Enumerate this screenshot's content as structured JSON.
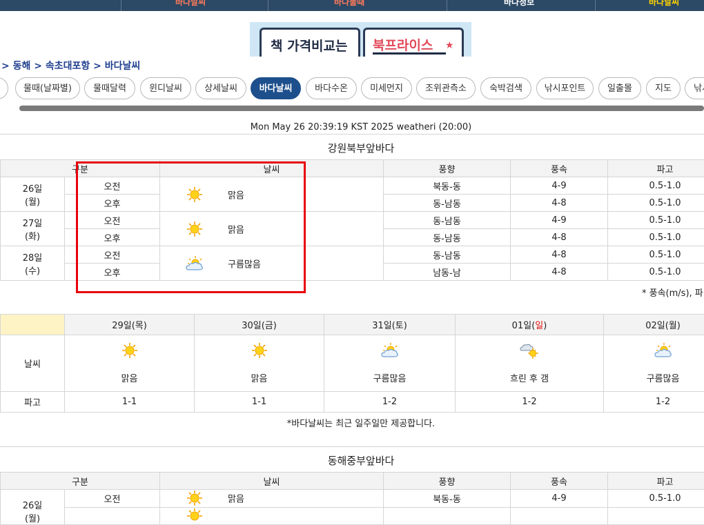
{
  "topnav": {
    "items": [
      "바다날씨",
      "바다날씨",
      "바다물때",
      "바다정보"
    ]
  },
  "banner": {
    "text_left": "책 가격비교는",
    "text_right": "북프라이스"
  },
  "breadcrumb": "> 동해 > 속초대포항 > 바다날씨",
  "tabs": [
    "물때(날짜별)",
    "물때달력",
    "윈디날씨",
    "상세날씨",
    "바다날씨",
    "바다수온",
    "미세먼지",
    "조위관측소",
    "숙박검색",
    "낚시포인트",
    "일출몰",
    "지도",
    "낚시"
  ],
  "active_tab": "바다날씨",
  "timestamp": "Mon May 26 20:39:19 KST 2025 weatheri (20:00)",
  "section1": {
    "title": "강원북부앞바다",
    "headers": [
      "구분",
      "날씨",
      "풍향",
      "풍속",
      "파고"
    ],
    "days": [
      {
        "date": "26일",
        "weekday": "(월)",
        "weather": "맑음",
        "icon": "sun-icon",
        "rows": [
          {
            "period": "오전",
            "wind_dir": "북동-동",
            "wind_speed": "4-9",
            "wave": "0.5-1.0"
          },
          {
            "period": "오후",
            "wind_dir": "동-남동",
            "wind_speed": "4-8",
            "wave": "0.5-1.0"
          }
        ]
      },
      {
        "date": "27일",
        "weekday": "(화)",
        "weather": "맑음",
        "icon": "sun-icon",
        "rows": [
          {
            "period": "오전",
            "wind_dir": "동-남동",
            "wind_speed": "4-9",
            "wave": "0.5-1.0"
          },
          {
            "period": "오후",
            "wind_dir": "동-남동",
            "wind_speed": "4-8",
            "wave": "0.5-1.0"
          }
        ]
      },
      {
        "date": "28일",
        "weekday": "(수)",
        "weather": "구름많음",
        "icon": "partly-cloudy-icon",
        "rows": [
          {
            "period": "오전",
            "wind_dir": "동-남동",
            "wind_speed": "4-8",
            "wave": "0.5-1.0"
          },
          {
            "period": "오후",
            "wind_dir": "남동-남",
            "wind_speed": "4-8",
            "wave": "0.5-1.0"
          }
        ]
      }
    ],
    "note": "* 풍속(m/s), 파"
  },
  "weekly": {
    "row_labels": {
      "weather": "날씨",
      "wave": "파고"
    },
    "days": [
      {
        "day": "29일",
        "dow": "(목)",
        "weather": "맑음",
        "icon": "sun-icon",
        "wave": "1-1"
      },
      {
        "day": "30일",
        "dow": "(금)",
        "weather": "맑음",
        "icon": "sun-icon",
        "wave": "1-1"
      },
      {
        "day": "31일",
        "dow": "(토)",
        "weather": "구름많음",
        "icon": "partly-cloudy-icon",
        "wave": "1-2"
      },
      {
        "day": "01일",
        "dow_open": "(",
        "dow": "일",
        "dow_close": ")",
        "weather": "흐린 후 갬",
        "icon": "cloud-then-sun-icon",
        "wave": "1-2"
      },
      {
        "day": "02일",
        "dow": "(월)",
        "weather": "구름많음",
        "icon": "partly-cloudy-icon",
        "wave": "1-2"
      }
    ],
    "note": "*바다날씨는 최근 일주일만 제공합니다."
  },
  "section2": {
    "title": "동해중부앞바다",
    "headers": [
      "구분",
      "날씨",
      "풍향",
      "풍속",
      "파고"
    ],
    "days": [
      {
        "date": "26일",
        "weekday": "(월)",
        "weather": "맑음",
        "icon": "sun-icon",
        "rows": [
          {
            "period": "오전",
            "wind_dir": "북동-동",
            "wind_speed": "4-9",
            "wave": "0.5-1.0"
          }
        ]
      }
    ]
  },
  "colors": {
    "nav_bg": "#2c4965",
    "active_tab": "#1d4f8c",
    "highlight": "#e8000b",
    "breadcrumb": "#1f3f8f"
  }
}
